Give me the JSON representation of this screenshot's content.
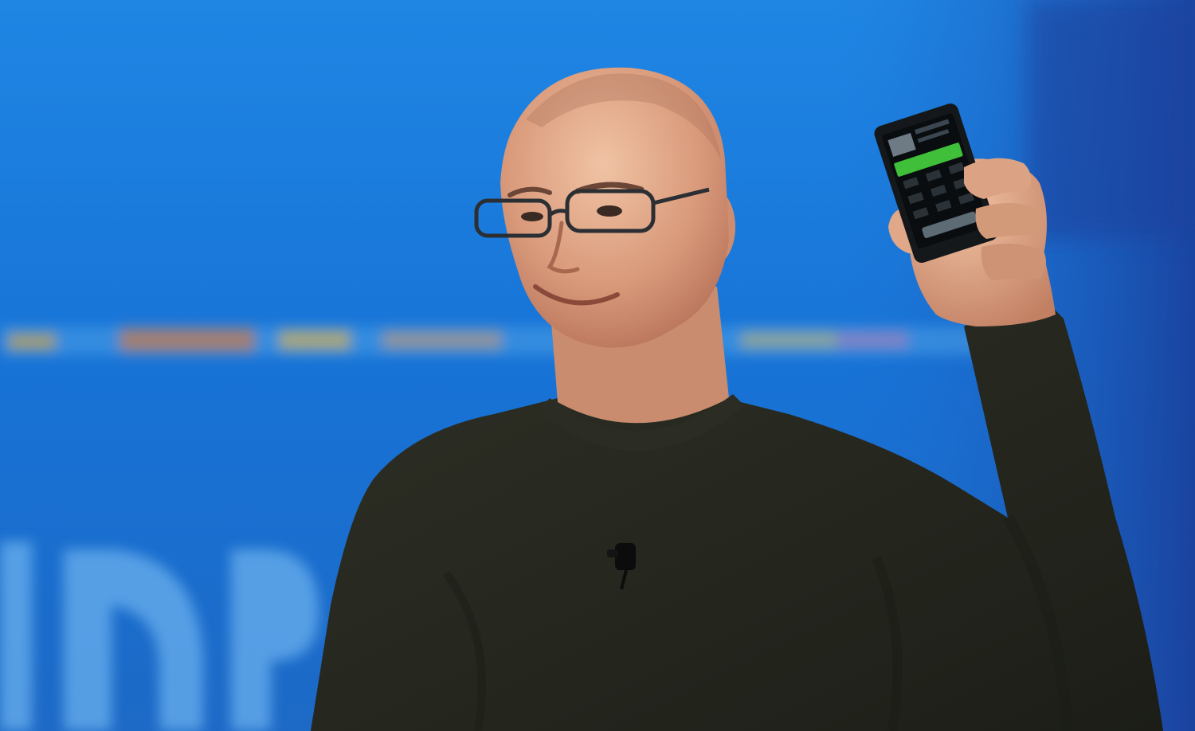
{
  "colors": {
    "backdrop_top": "#1f87e6",
    "backdrop_mid": "#1470d4",
    "backdrop_bottom": "#1b6ac8",
    "backdrop_right": "#1a3f9a",
    "sweater": "#26281f",
    "skin": "#d99c7e",
    "phone_body": "#15181b",
    "phone_screen_accent": "#3fbf3a"
  },
  "scene": {
    "subject": "person",
    "held_object": "phone-icon",
    "accessory": "glasses-icon"
  }
}
